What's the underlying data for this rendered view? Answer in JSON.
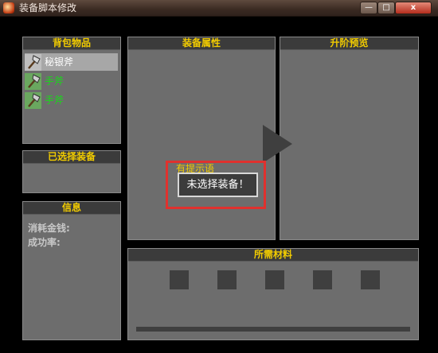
{
  "window": {
    "title": "装备脚本修改",
    "minimize": "—",
    "maximize": "□",
    "close": "x"
  },
  "backpack": {
    "title": "背包物品",
    "items": [
      {
        "name": "秘银斧",
        "selected": true
      },
      {
        "name": "手斧",
        "selected": false
      },
      {
        "name": "手斧",
        "selected": false
      }
    ]
  },
  "selected_equipment": {
    "title": "已选择装备"
  },
  "info": {
    "title": "信息",
    "cost_label": "消耗金钱:",
    "success_label": "成功率:"
  },
  "attributes": {
    "title": "装备属性"
  },
  "upgrade_preview": {
    "title": "升阶预览"
  },
  "materials": {
    "title": "所需材料",
    "slot_count": 5
  },
  "hint": {
    "label": "有提示语",
    "message": "未选择装备！"
  },
  "colors": {
    "accent": "#f2cc00",
    "item_green": "#19d819",
    "highlight": "#e0312e"
  }
}
